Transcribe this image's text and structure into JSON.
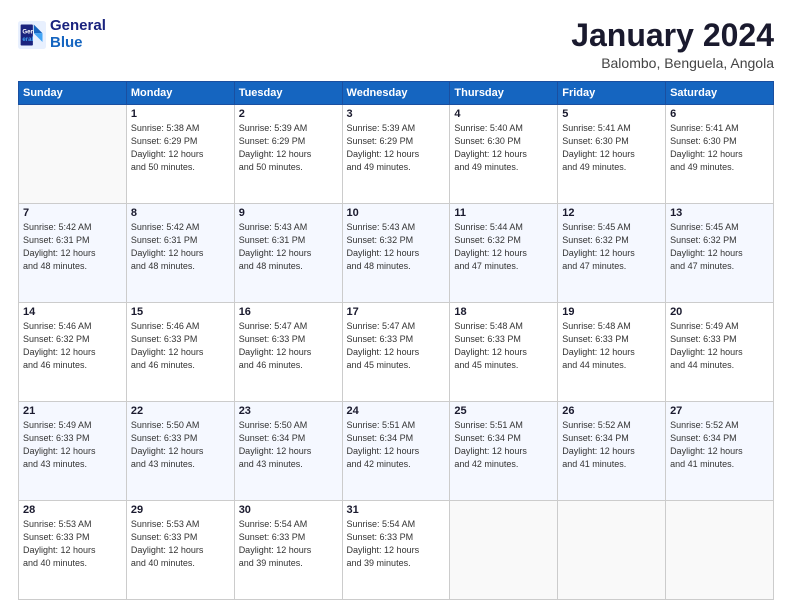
{
  "header": {
    "logo_line1": "General",
    "logo_line2": "Blue",
    "title": "January 2024",
    "subtitle": "Balombo, Benguela, Angola"
  },
  "calendar": {
    "headers": [
      "Sunday",
      "Monday",
      "Tuesday",
      "Wednesday",
      "Thursday",
      "Friday",
      "Saturday"
    ],
    "weeks": [
      [
        {
          "day": "",
          "info": ""
        },
        {
          "day": "1",
          "info": "Sunrise: 5:38 AM\nSunset: 6:29 PM\nDaylight: 12 hours\nand 50 minutes."
        },
        {
          "day": "2",
          "info": "Sunrise: 5:39 AM\nSunset: 6:29 PM\nDaylight: 12 hours\nand 50 minutes."
        },
        {
          "day": "3",
          "info": "Sunrise: 5:39 AM\nSunset: 6:29 PM\nDaylight: 12 hours\nand 49 minutes."
        },
        {
          "day": "4",
          "info": "Sunrise: 5:40 AM\nSunset: 6:30 PM\nDaylight: 12 hours\nand 49 minutes."
        },
        {
          "day": "5",
          "info": "Sunrise: 5:41 AM\nSunset: 6:30 PM\nDaylight: 12 hours\nand 49 minutes."
        },
        {
          "day": "6",
          "info": "Sunrise: 5:41 AM\nSunset: 6:30 PM\nDaylight: 12 hours\nand 49 minutes."
        }
      ],
      [
        {
          "day": "7",
          "info": "Sunrise: 5:42 AM\nSunset: 6:31 PM\nDaylight: 12 hours\nand 48 minutes."
        },
        {
          "day": "8",
          "info": "Sunrise: 5:42 AM\nSunset: 6:31 PM\nDaylight: 12 hours\nand 48 minutes."
        },
        {
          "day": "9",
          "info": "Sunrise: 5:43 AM\nSunset: 6:31 PM\nDaylight: 12 hours\nand 48 minutes."
        },
        {
          "day": "10",
          "info": "Sunrise: 5:43 AM\nSunset: 6:32 PM\nDaylight: 12 hours\nand 48 minutes."
        },
        {
          "day": "11",
          "info": "Sunrise: 5:44 AM\nSunset: 6:32 PM\nDaylight: 12 hours\nand 47 minutes."
        },
        {
          "day": "12",
          "info": "Sunrise: 5:45 AM\nSunset: 6:32 PM\nDaylight: 12 hours\nand 47 minutes."
        },
        {
          "day": "13",
          "info": "Sunrise: 5:45 AM\nSunset: 6:32 PM\nDaylight: 12 hours\nand 47 minutes."
        }
      ],
      [
        {
          "day": "14",
          "info": "Sunrise: 5:46 AM\nSunset: 6:32 PM\nDaylight: 12 hours\nand 46 minutes."
        },
        {
          "day": "15",
          "info": "Sunrise: 5:46 AM\nSunset: 6:33 PM\nDaylight: 12 hours\nand 46 minutes."
        },
        {
          "day": "16",
          "info": "Sunrise: 5:47 AM\nSunset: 6:33 PM\nDaylight: 12 hours\nand 46 minutes."
        },
        {
          "day": "17",
          "info": "Sunrise: 5:47 AM\nSunset: 6:33 PM\nDaylight: 12 hours\nand 45 minutes."
        },
        {
          "day": "18",
          "info": "Sunrise: 5:48 AM\nSunset: 6:33 PM\nDaylight: 12 hours\nand 45 minutes."
        },
        {
          "day": "19",
          "info": "Sunrise: 5:48 AM\nSunset: 6:33 PM\nDaylight: 12 hours\nand 44 minutes."
        },
        {
          "day": "20",
          "info": "Sunrise: 5:49 AM\nSunset: 6:33 PM\nDaylight: 12 hours\nand 44 minutes."
        }
      ],
      [
        {
          "day": "21",
          "info": "Sunrise: 5:49 AM\nSunset: 6:33 PM\nDaylight: 12 hours\nand 43 minutes."
        },
        {
          "day": "22",
          "info": "Sunrise: 5:50 AM\nSunset: 6:33 PM\nDaylight: 12 hours\nand 43 minutes."
        },
        {
          "day": "23",
          "info": "Sunrise: 5:50 AM\nSunset: 6:34 PM\nDaylight: 12 hours\nand 43 minutes."
        },
        {
          "day": "24",
          "info": "Sunrise: 5:51 AM\nSunset: 6:34 PM\nDaylight: 12 hours\nand 42 minutes."
        },
        {
          "day": "25",
          "info": "Sunrise: 5:51 AM\nSunset: 6:34 PM\nDaylight: 12 hours\nand 42 minutes."
        },
        {
          "day": "26",
          "info": "Sunrise: 5:52 AM\nSunset: 6:34 PM\nDaylight: 12 hours\nand 41 minutes."
        },
        {
          "day": "27",
          "info": "Sunrise: 5:52 AM\nSunset: 6:34 PM\nDaylight: 12 hours\nand 41 minutes."
        }
      ],
      [
        {
          "day": "28",
          "info": "Sunrise: 5:53 AM\nSunset: 6:33 PM\nDaylight: 12 hours\nand 40 minutes."
        },
        {
          "day": "29",
          "info": "Sunrise: 5:53 AM\nSunset: 6:33 PM\nDaylight: 12 hours\nand 40 minutes."
        },
        {
          "day": "30",
          "info": "Sunrise: 5:54 AM\nSunset: 6:33 PM\nDaylight: 12 hours\nand 39 minutes."
        },
        {
          "day": "31",
          "info": "Sunrise: 5:54 AM\nSunset: 6:33 PM\nDaylight: 12 hours\nand 39 minutes."
        },
        {
          "day": "",
          "info": ""
        },
        {
          "day": "",
          "info": ""
        },
        {
          "day": "",
          "info": ""
        }
      ]
    ]
  }
}
